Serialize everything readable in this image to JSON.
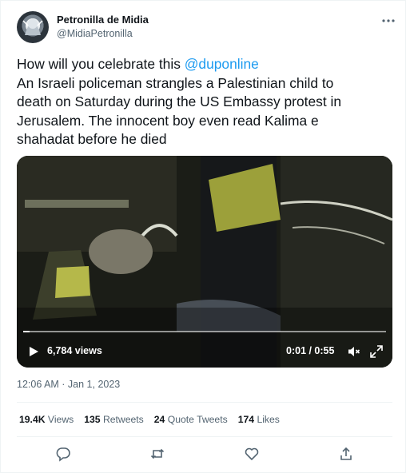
{
  "author": {
    "display_name": "Petronilla de Midia",
    "handle": "@MidiaPetronilla",
    "avatar_icon": "profile-avatar"
  },
  "more_icon": "ellipsis-icon",
  "tweet": {
    "lines": [
      {
        "prefix": "How will you celebrate this ",
        "mention": "@duponline"
      },
      {
        "text": "An Israeli policeman strangles a Palestinian child to"
      },
      {
        "text": "death on Saturday during the US Embassy protest in"
      },
      {
        "text": "Jerusalem.  The innocent boy even read Kalima e"
      },
      {
        "text": "shahadat before he died"
      }
    ]
  },
  "video": {
    "views_label": "6,784 views",
    "time_label": "0:01 / 0:55",
    "progress": 0.0182,
    "icons": [
      "play-icon",
      "mute-icon",
      "fullscreen-icon"
    ]
  },
  "timestamp": "12:06 AM · Jan 1, 2023",
  "stats": [
    {
      "count": "19.4K",
      "label": "Views"
    },
    {
      "count": "135",
      "label": "Retweets"
    },
    {
      "count": "24",
      "label": "Quote Tweets"
    },
    {
      "count": "174",
      "label": "Likes"
    }
  ],
  "actions": [
    "reply-icon",
    "retweet-icon",
    "like-icon",
    "share-icon"
  ],
  "colors": {
    "accent": "#1d9bf0",
    "text_primary": "#0f1419",
    "text_secondary": "#536471",
    "border": "#eff3f4"
  }
}
